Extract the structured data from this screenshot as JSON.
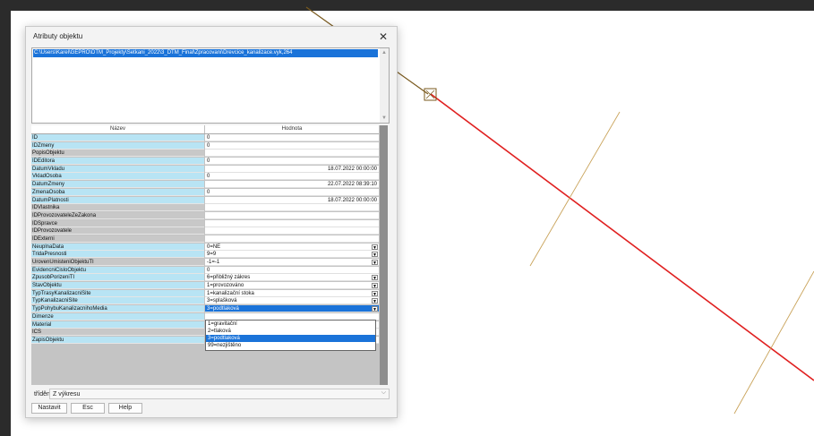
{
  "dialog": {
    "title": "Atributy objektu",
    "close_symbol": "✕",
    "path_text": "C:\\Users\\Karel\\GEPRO\\DTM_Projekty\\Setkani_2022\\3_DTM_Final\\Zpracovani\\Drevcice_kanalizace.vyk,264",
    "scroll_up_icon": "▲",
    "scroll_down_icon": "▼"
  },
  "grid": {
    "header_name": "Název",
    "header_value": "Hodnota",
    "dropdown_arrow": "▼",
    "rows": [
      {
        "name": "ID",
        "value": "0"
      },
      {
        "name": "IDZmeny",
        "value": "0"
      },
      {
        "name": "PopisObjektu",
        "value": ""
      },
      {
        "name": "IDEditora",
        "value": "0"
      },
      {
        "name": "DatumVkladu",
        "value": "18.07.2022 00:00:00"
      },
      {
        "name": "VkladOsoba",
        "value": "0"
      },
      {
        "name": "DatumZmeny",
        "value": "22.07.2022 08:39:10"
      },
      {
        "name": "ZmenaOsoba",
        "value": "0"
      },
      {
        "name": "DatumPlatnosti",
        "value": "18.07.2022 00:00:00"
      },
      {
        "name": "IDVlastnika",
        "value": ""
      },
      {
        "name": "IDProvozovateleZeZakona",
        "value": ""
      },
      {
        "name": "IDSpravce",
        "value": ""
      },
      {
        "name": "IDProvozovatele",
        "value": ""
      },
      {
        "name": "IDExterni",
        "value": ""
      },
      {
        "name": "NeuplnaData",
        "value": "0=NE"
      },
      {
        "name": "TridaPresnosti",
        "value": "9=9"
      },
      {
        "name": "UrovenUmisteniObjektuTI",
        "value": "-1=-1"
      },
      {
        "name": "EvidencniCisloObjektu",
        "value": "0"
      },
      {
        "name": "ZpusobPorizeniTI",
        "value": "6=přibližný zákres"
      },
      {
        "name": "StavObjektu",
        "value": "1=provozováno"
      },
      {
        "name": "TypTrasyKanalizacniSite",
        "value": "1=kanalizační stoka"
      },
      {
        "name": "TypKanalizacniSite",
        "value": "3=splašková"
      },
      {
        "name": "TypPohybuKanalizacnihoMedia",
        "value": "3=podtlaková"
      },
      {
        "name": "Dimenze",
        "value": ""
      },
      {
        "name": "Material",
        "value": ""
      },
      {
        "name": "ICS",
        "value": ""
      },
      {
        "name": "ZapisObjektu",
        "value": ""
      }
    ],
    "dropdown_options": [
      "1=gravitační",
      "2=tlaková",
      "3=podtlaková",
      "99=nezjištěno"
    ],
    "dropdown_selected": "3=podtlaková"
  },
  "sort": {
    "label": "třídění",
    "value": "Z výkresu",
    "chevron": "⌵"
  },
  "buttons": {
    "set": "Nastavit",
    "esc": "Esc",
    "help": "Help"
  },
  "colors": {
    "cad_red": "#e02020",
    "cad_brown": "#7a5a1e",
    "cad_tan": "#c9a35a",
    "selection_blue": "#1a73d9",
    "name_cell_blue": "#b8e4f4"
  }
}
